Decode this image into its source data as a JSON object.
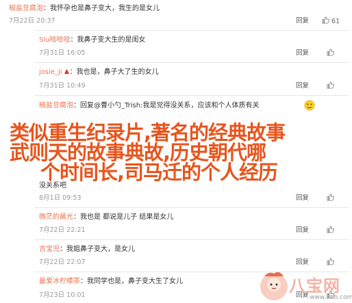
{
  "comments": [
    {
      "name": "椒盐豆腐泡",
      "sep": "：",
      "text": "我怀孕也是鼻子变大，我生的是女儿",
      "date": "7月22日 20:37",
      "reply": "回复",
      "likes": "61"
    },
    {
      "name": "Slu哈哈哈",
      "sep": "：",
      "text": "我鼻子变大生的是闺女",
      "date": "7月31日 16:05",
      "reply": "回复",
      "likes": ""
    },
    {
      "name": "josie_ji",
      "sep": "：",
      "text": "我也是，鼻子大了生的女儿",
      "date": "7月31日 10:49",
      "reply": "回复",
      "likes": ""
    },
    {
      "name": "椒盐豆腐泡",
      "sep": "：",
      "text": "回复@曹小勺_Trish:我是觉得没关系，应该和个人体质有关",
      "date": "",
      "reply": "回复",
      "likes": ""
    },
    {
      "name": "",
      "sep": "",
      "text": "没关系吧",
      "date": "8月1日 09:53",
      "reply": "回复",
      "likes": ""
    },
    {
      "name": "微茫的晨光",
      "sep": "：",
      "text": "我也是 都说是儿子 结果是女儿",
      "date": "7月22日 22:21",
      "reply": "回复",
      "likes": ""
    },
    {
      "name": "吉宝児",
      "sep": "：",
      "text": "我姐鼻子变大，是女儿",
      "date": "7月22日 22:07",
      "reply": "回复",
      "likes": ""
    },
    {
      "name": "最爱冰柠檬茶",
      "sep": "：",
      "text": "我同学也是，鼻子变大生了女儿",
      "date": "7月23日 10:01",
      "reply": "回复",
      "likes": ""
    }
  ],
  "overlay": {
    "line1": "类似重生纪录片,著名的经典故事",
    "line2": "武则天的故事典故,历史朝代哪",
    "line3": "个时间长,司马迁的个人经历"
  },
  "watermark": {
    "brand": "八宝网",
    "url": "www.8bb.com"
  },
  "colors": {
    "name": "#eb7350",
    "overlay": "#e8541c",
    "date": "#999999"
  }
}
